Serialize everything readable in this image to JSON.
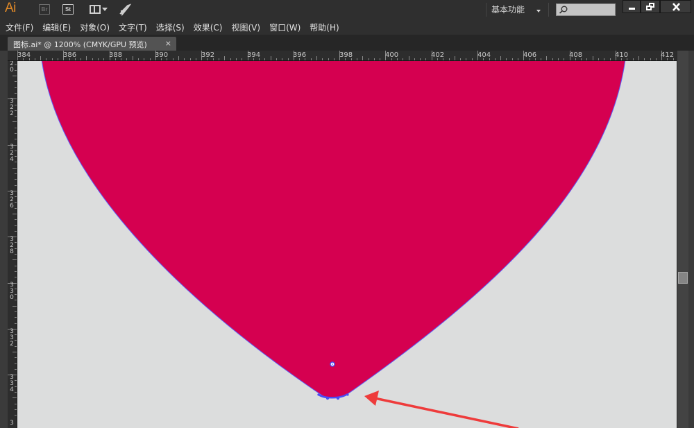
{
  "appbar": {
    "logo": "Ai",
    "br_label": "Br",
    "st_label": "St",
    "workspace": "基本功能",
    "search_placeholder": ""
  },
  "menu": [
    {
      "label": "文件(F)"
    },
    {
      "label": "编辑(E)"
    },
    {
      "label": "对象(O)"
    },
    {
      "label": "文字(T)"
    },
    {
      "label": "选择(S)"
    },
    {
      "label": "效果(C)"
    },
    {
      "label": "视图(V)"
    },
    {
      "label": "窗口(W)"
    },
    {
      "label": "帮助(H)"
    }
  ],
  "document": {
    "tab_title": "图标.ai* @ 1200% (CMYK/GPU 预览)",
    "close_glyph": "×",
    "zoom": "1200%"
  },
  "ruler_h": [
    "384",
    "386",
    "388",
    "390",
    "392",
    "394",
    "396",
    "398",
    "400",
    "402",
    "404",
    "406",
    "408",
    "410",
    "412"
  ],
  "ruler_v": [
    "2\n0",
    "3\n2\n2",
    "3\n2\n4",
    "3\n2\n6",
    "3\n2\n8",
    "3\n3\n0",
    "3\n3\n2",
    "3\n3\n4",
    "3"
  ],
  "colors": {
    "shape_fill": "#d50050",
    "path_outline": "#5b5cf6",
    "annotation_arrow": "#ee3b3b",
    "canvas": "#dcdddd",
    "ai_logo": "#e28a27"
  },
  "icons": {
    "rocket": "send-rocket-icon",
    "layout": "arrange-documents-icon",
    "search": "search-icon"
  }
}
